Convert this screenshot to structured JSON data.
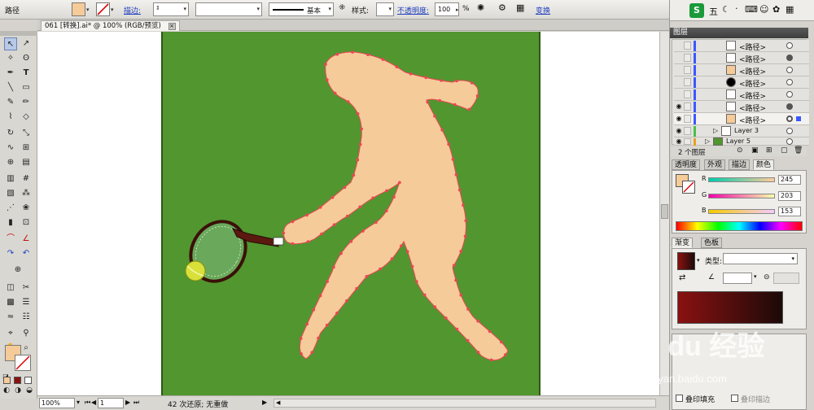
{
  "control_bar": {
    "object_type": "路径",
    "stroke_label": "描边:",
    "stroke_weight": "",
    "brush_label": "基本",
    "style_label": "样式:",
    "opacity_label": "不透明度:",
    "opacity_value": "100",
    "opacity_unit": "%",
    "transform_label": "变换"
  },
  "document": {
    "tab_title": "061 [转换].ai* @ 100% (RGB/预览)"
  },
  "status_bar": {
    "zoom": "100%",
    "page": "1",
    "history": "42 次还原; 无重做"
  },
  "ime": {
    "mode": "五",
    "extra": "·"
  },
  "layers_panel": {
    "title": "图层",
    "rows": [
      {
        "name": "<路径>",
        "indent": 2
      },
      {
        "name": "<路径>",
        "indent": 2
      },
      {
        "name": "<路径>",
        "indent": 2
      },
      {
        "name": "<路径>",
        "indent": 2
      },
      {
        "name": "<路径>",
        "indent": 2
      },
      {
        "name": "<路径>",
        "indent": 2
      },
      {
        "name": "<路径>",
        "indent": 2
      },
      {
        "name": "Layer 3",
        "indent": 1
      },
      {
        "name": "Layer 5",
        "indent": 0
      }
    ],
    "count": "2 个图层"
  },
  "color_panel": {
    "tabs": [
      "透明度",
      "外观",
      "描边",
      "颜色"
    ],
    "channels": [
      {
        "name": "R",
        "value": "245"
      },
      {
        "name": "G",
        "value": "203"
      },
      {
        "name": "B",
        "value": "153"
      }
    ]
  },
  "gradient_panel": {
    "tabs": [
      "渐变",
      "色板"
    ],
    "type_label": "类型:",
    "type_value": ""
  },
  "attributes": {
    "overprint_fill": "叠印填充",
    "overprint_stroke": "叠印描边"
  },
  "watermark": {
    "logo": "Bai du 经验",
    "url": "jingyan.baidu.com"
  },
  "colors": {
    "fill": "#f5cb99",
    "artboard_bg": "#51962f",
    "gradient_start": "#8a1111",
    "gradient_end": "#1c0a08",
    "anchor": "#ee4455"
  }
}
